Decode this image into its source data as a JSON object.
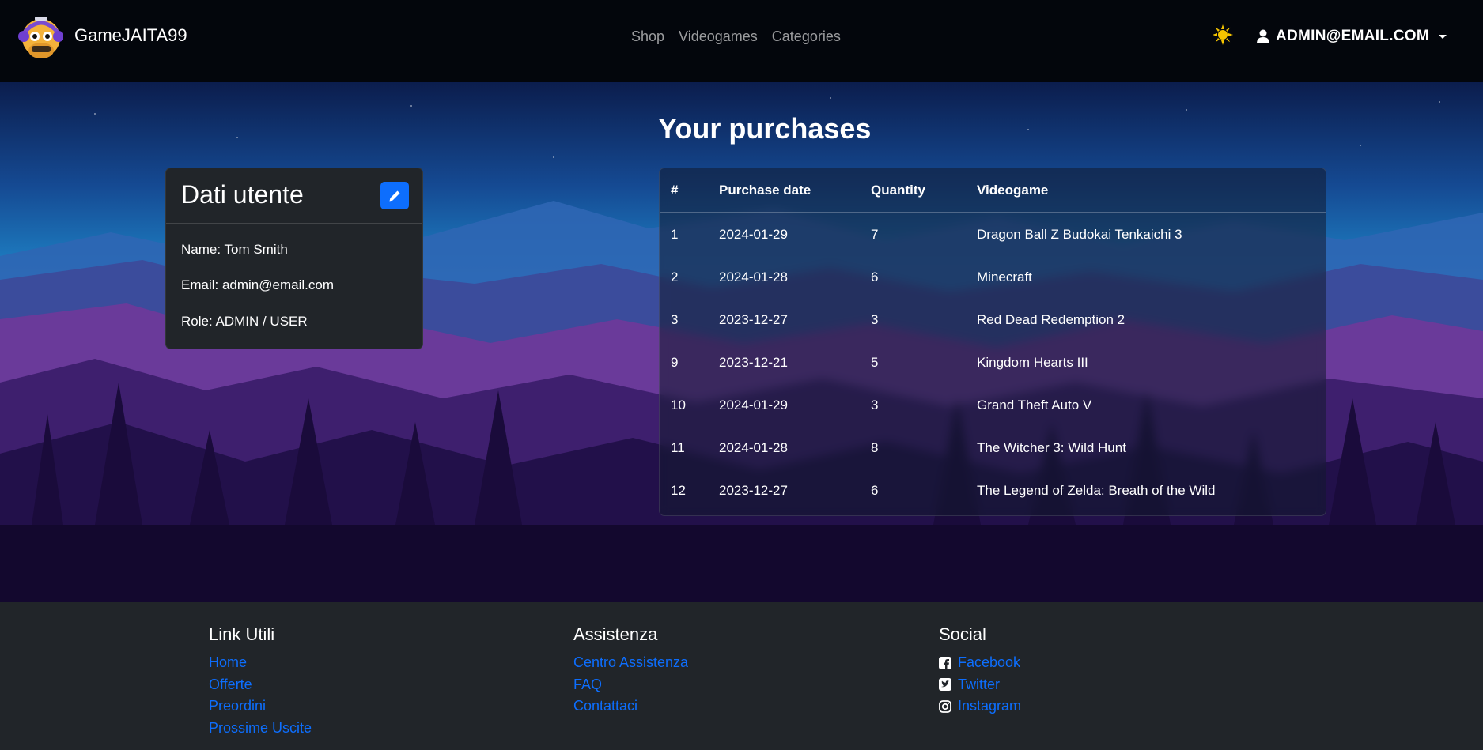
{
  "navbar": {
    "brand": "GameJAITA99",
    "links": [
      "Shop",
      "Videogames",
      "Categories"
    ],
    "user_label": "ADMIN@EMAIL.COM",
    "theme_icon": "sun-icon",
    "colors": {
      "background": "#03060c",
      "theme_icon": "#f5c400"
    }
  },
  "main": {
    "title": "Your purchases",
    "user_card": {
      "title": "Dati utente",
      "name": "Name: Tom Smith",
      "email": "Email: admin@email.com",
      "role": "Role: ADMIN / USER",
      "edit_icon": "pencil-icon"
    },
    "table": {
      "headers": [
        "#",
        "Purchase date",
        "Quantity",
        "Videogame"
      ],
      "rows": [
        {
          "id": "1",
          "date": "2024-01-29",
          "qty": "7",
          "game": "Dragon Ball Z Budokai Tenkaichi 3"
        },
        {
          "id": "2",
          "date": "2024-01-28",
          "qty": "6",
          "game": "Minecraft"
        },
        {
          "id": "3",
          "date": "2023-12-27",
          "qty": "3",
          "game": "Red Dead Redemption 2"
        },
        {
          "id": "9",
          "date": "2023-12-21",
          "qty": "5",
          "game": "Kingdom Hearts III"
        },
        {
          "id": "10",
          "date": "2024-01-29",
          "qty": "3",
          "game": "Grand Theft Auto V"
        },
        {
          "id": "11",
          "date": "2024-01-28",
          "qty": "8",
          "game": "The Witcher 3: Wild Hunt"
        },
        {
          "id": "12",
          "date": "2023-12-27",
          "qty": "6",
          "game": "The Legend of Zelda: Breath of the Wild"
        }
      ]
    }
  },
  "footer": {
    "columns": [
      {
        "title": "Link Utili",
        "links": [
          "Home",
          "Offerte",
          "Preordini",
          "Prossime Uscite"
        ]
      },
      {
        "title": "Assistenza",
        "links": [
          "Centro Assistenza",
          "FAQ",
          "Contattaci"
        ]
      },
      {
        "title": "Social",
        "links": [
          "Facebook",
          "Twitter",
          "Instagram"
        ],
        "icons": [
          "facebook-icon",
          "twitter-icon",
          "instagram-icon"
        ]
      }
    ],
    "colors": {
      "link": "#0d6efd",
      "background": "#212529"
    }
  }
}
